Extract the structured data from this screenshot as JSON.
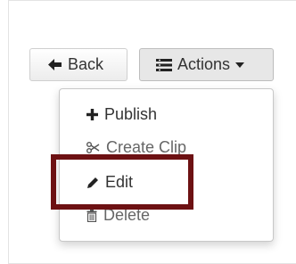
{
  "toolbar": {
    "back_label": "Back",
    "actions_label": "Actions"
  },
  "menu": {
    "items": [
      {
        "label": "Publish",
        "icon": "plus-icon"
      },
      {
        "label": "Create Clip",
        "icon": "scissors-icon"
      },
      {
        "label": "Edit",
        "icon": "pencil-icon"
      },
      {
        "label": "Delete",
        "icon": "trash-icon"
      }
    ]
  },
  "colors": {
    "highlight_border": "#6d1113"
  }
}
